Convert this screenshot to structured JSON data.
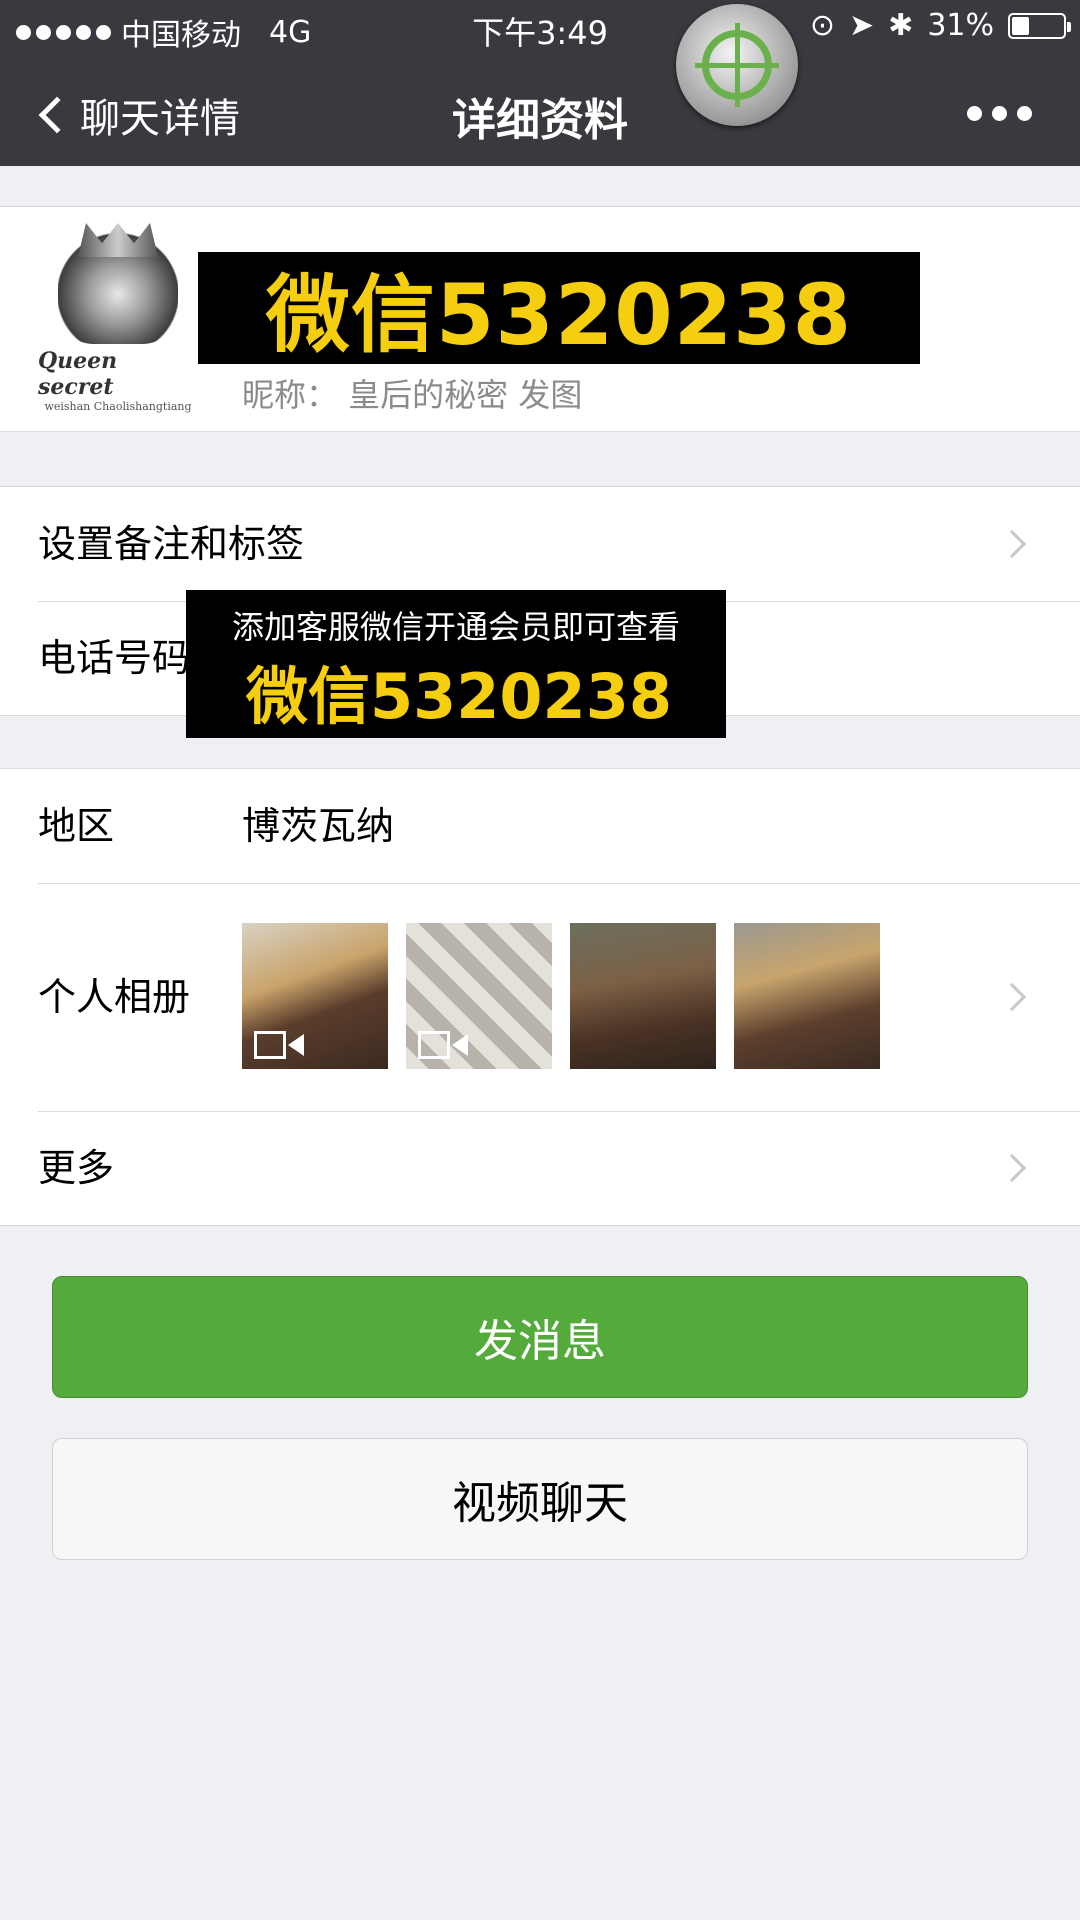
{
  "status_bar": {
    "carrier": "中国移动",
    "network": "4G",
    "time": "下午3:49",
    "battery": "31%",
    "battery_level": 0.31
  },
  "nav": {
    "back_label": "聊天详情",
    "title": "详细资料"
  },
  "avatar": {
    "brand": "Queen secret",
    "tagline": "weishan Chaolishangtiang"
  },
  "profile": {
    "banner_text": "微信5320238",
    "nickname": "昵称：  皇后的秘密 发图"
  },
  "cells": {
    "remark_label": "设置备注和标签",
    "phone_label": "电话号码",
    "region_label": "地区",
    "region_value": "博茨瓦纳",
    "album_label": "个人相册",
    "more_label": "更多"
  },
  "overlay": {
    "subtitle": "添加客服微信开通会员即可查看",
    "wechat": "微信5320238"
  },
  "buttons": {
    "send_message": "发消息",
    "video_chat": "视频聊天"
  },
  "colors": {
    "nav_bg": "#393a3f",
    "primary_green": "#54aa3a",
    "banner_yellow": "#f5cf0f"
  }
}
